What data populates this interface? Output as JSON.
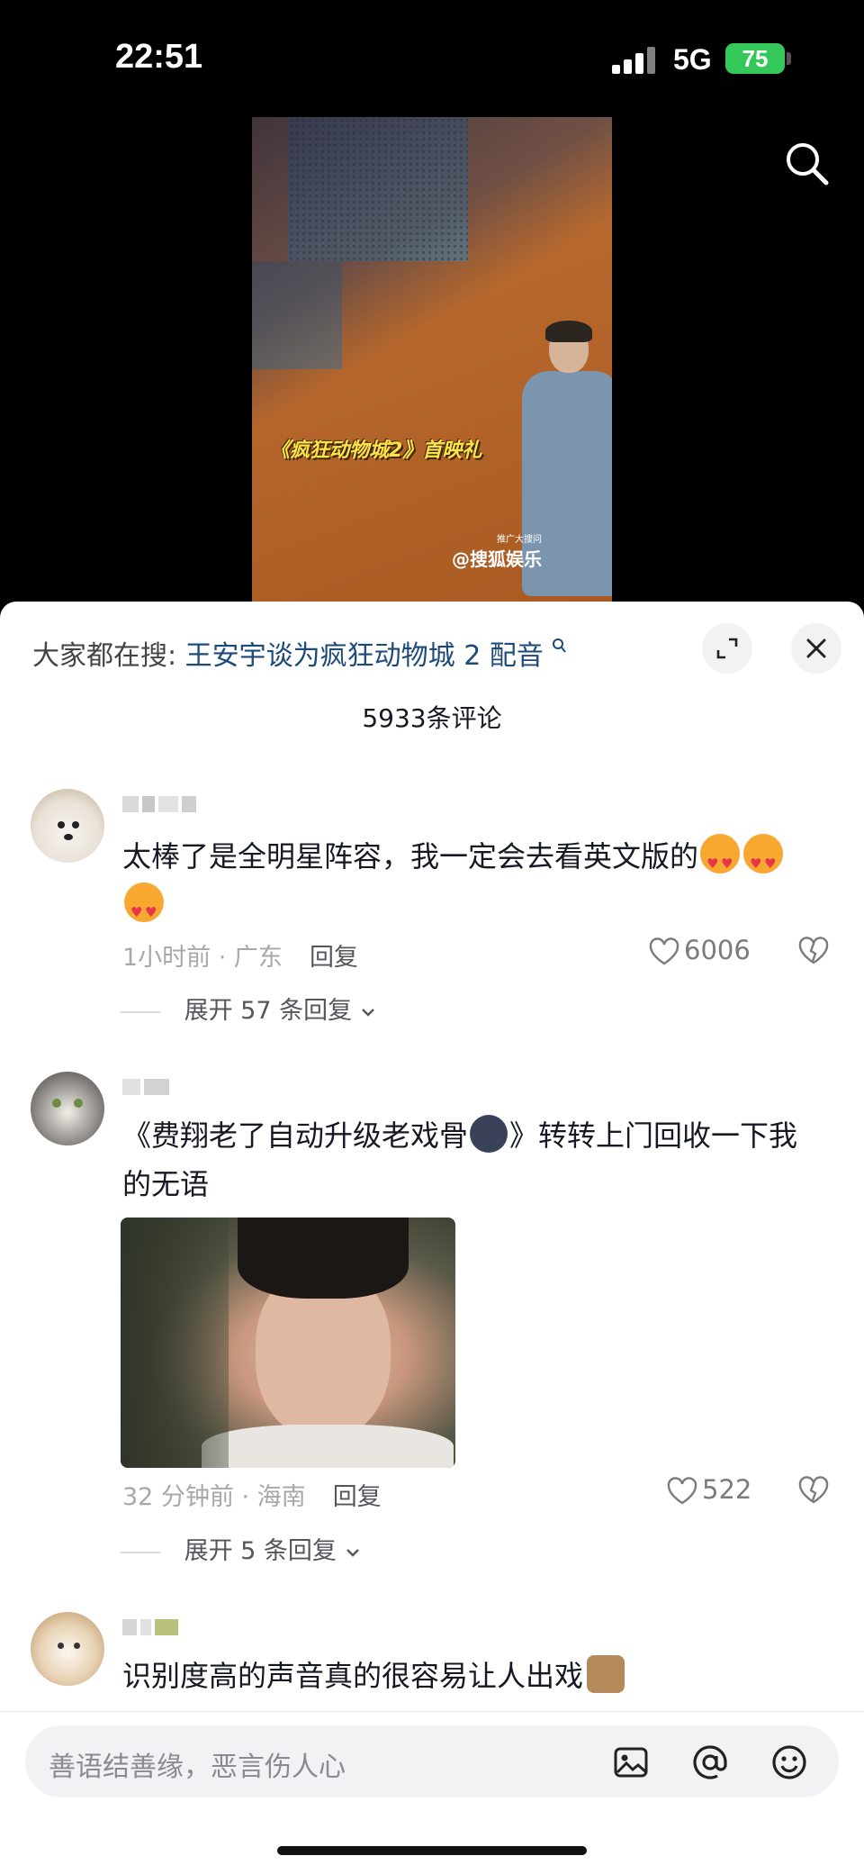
{
  "status_bar": {
    "time": "22:51",
    "network": "5G",
    "battery": "75"
  },
  "video": {
    "caption": "《疯狂动物城2》首映礼",
    "watermark_small": "推广大搜问",
    "watermark": "@搜狐娱乐"
  },
  "header": {
    "hot_search_label": "大家都在搜:",
    "hot_search_keyword": "王安宇谈为疯狂动物城 2 配音",
    "comment_count": "5933条评论"
  },
  "comments": [
    {
      "text": "太棒了是全明星阵容，我一定会去看英文版的",
      "time_location": "1小时前 · 广东",
      "reply_label": "回复",
      "likes": "6006",
      "expand": "展开 57 条回复"
    },
    {
      "text_part1": "《费翔老了自动升级老戏骨",
      "text_part2": "》转转上门回收一下我的无语",
      "time_location": "32 分钟前 · 海南",
      "reply_label": "回复",
      "likes": "522",
      "expand": "展开 5 条回复"
    },
    {
      "text": "识别度高的声音真的很容易让人出戏"
    }
  ],
  "input": {
    "placeholder": "善语结善缘，恶言伤人心"
  },
  "icons": [
    "search-icon",
    "fullscreen-icon",
    "close-icon",
    "heart-icon",
    "dislike-icon",
    "chevron-down-icon",
    "image-icon",
    "at-icon",
    "emoji-icon"
  ],
  "colors": {
    "battery": "#34c759",
    "keyword": "#1e4a7a",
    "sheet": "#ffffff"
  }
}
